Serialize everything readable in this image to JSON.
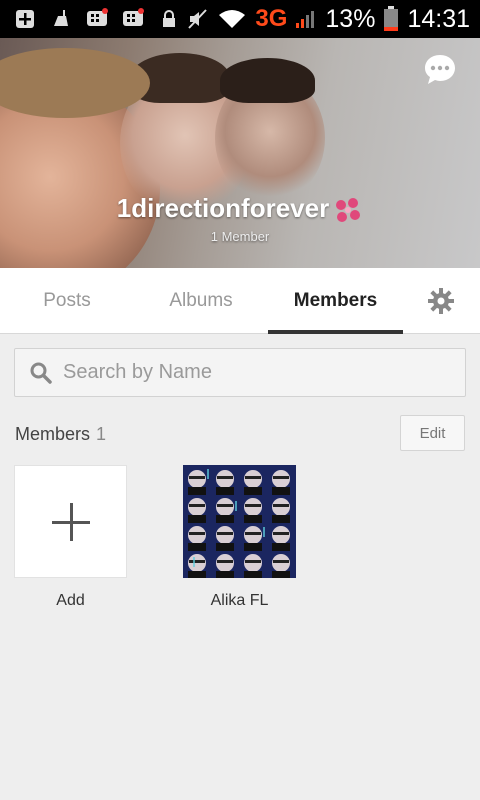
{
  "status_bar": {
    "icons": [
      "add-notification-icon",
      "cleaner-icon",
      "bbm-icon",
      "bbm-icon",
      "lock-icon",
      "mute-icon",
      "wifi-icon",
      "signal-icon",
      "battery-icon"
    ],
    "network": "3G",
    "battery": "13%",
    "time": "14:31"
  },
  "group": {
    "name": "1directionforever",
    "subtitle": "1 Member",
    "accent": "#e0487b"
  },
  "tabs": [
    {
      "label": "Posts",
      "active": false
    },
    {
      "label": "Albums",
      "active": false
    },
    {
      "label": "Members",
      "active": true
    }
  ],
  "search": {
    "placeholder": "Search by Name",
    "value": ""
  },
  "members_section": {
    "title": "Members",
    "count": "1",
    "edit_label": "Edit"
  },
  "tiles": [
    {
      "label": "Add",
      "type": "add"
    },
    {
      "label": "Alika FL",
      "type": "member"
    }
  ]
}
